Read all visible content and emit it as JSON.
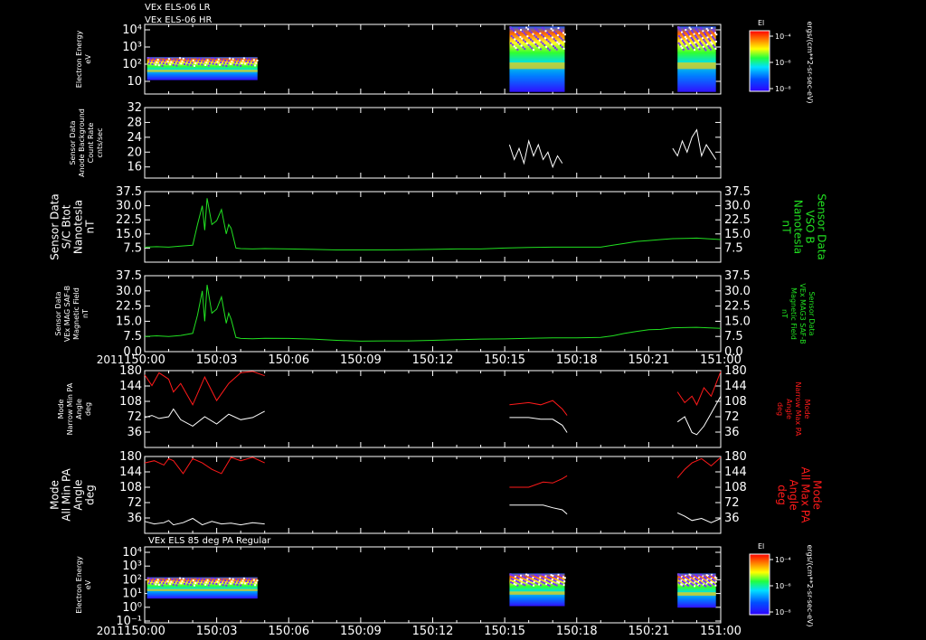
{
  "header": {
    "line1": "VEx ELS-06 LR",
    "line2": "VEx ELS-06 HR"
  },
  "colors": {
    "bg": "#000000",
    "axis": "#ffffff",
    "green": "#21e021",
    "red": "#ff1a1a",
    "white": "#ffffff"
  },
  "x_axis": {
    "year": "2011",
    "ticks": [
      "150:00",
      "150:03",
      "150:06",
      "150:09",
      "150:12",
      "150:15",
      "150:18",
      "150:21",
      "151:00"
    ]
  },
  "panels": {
    "energy1": {
      "ylabel": [
        "Electron Energy",
        "eV"
      ],
      "yticks": [
        "10⁴",
        "10³",
        "10²",
        "10"
      ],
      "colorbar": {
        "title": "El",
        "ticks": [
          "10⁻⁴",
          "10⁻⁶",
          "10⁻⁸"
        ],
        "unit": "ergs/(cm**2-sr-sec-eV)"
      }
    },
    "sensor": {
      "ylabel": [
        "Sensor Data",
        "Anode Background",
        "Count Rate",
        "cnts/sec"
      ],
      "yticks": [
        "32",
        "28",
        "24",
        "20",
        "16"
      ]
    },
    "bmag1": {
      "ylabel": [
        "Sensor Data",
        "S/C Btot",
        "Nanotesla",
        "nT"
      ],
      "yticks": [
        "37.5",
        "30.0",
        "22.5",
        "15.0",
        "7.5"
      ],
      "rlabel": [
        "Sensor Data",
        "VSO B",
        "Nanotesla",
        "nT"
      ]
    },
    "bmag2": {
      "ylabel": [
        "Sensor Data",
        "VEx MAG SAF-B",
        "Magnetic Field",
        "nT"
      ],
      "yticks": [
        "37.5",
        "30.0",
        "22.5",
        "15.0",
        "7.5",
        "0.0"
      ],
      "rlabel": [
        "Sensor Data",
        "VEx MAG3 SAF-B",
        "Magnetic Field",
        "nT"
      ]
    },
    "pa_narrow": {
      "ylabel": [
        "Mode",
        "Narrow Min PA",
        "Angle",
        "deg"
      ],
      "yticks": [
        "180",
        "144",
        "108",
        "72",
        "36"
      ],
      "rlabel": [
        "Mode",
        "Narrow Max PA",
        "Angle",
        "deg"
      ]
    },
    "pa_all": {
      "ylabel": [
        "Mode",
        "All Min PA",
        "Angle",
        "deg"
      ],
      "yticks": [
        "180",
        "144",
        "108",
        "72",
        "36"
      ],
      "rlabel": [
        "Mode",
        "All Max PA",
        "Angle",
        "deg"
      ]
    },
    "energy2": {
      "title": "VEx ELS 85 deg PA Regular",
      "ylabel": [
        "Electron Energy",
        "eV"
      ],
      "yticks": [
        "10⁴",
        "10³",
        "10²",
        "10¹",
        "10⁰",
        "10⁻¹"
      ],
      "colorbar": {
        "title": "El",
        "ticks": [
          "10⁻⁴",
          "10⁻⁶",
          "10⁻⁸"
        ],
        "unit": "ergs/(cm**2-sr-sec-eV)"
      }
    }
  },
  "chart_data": [
    {
      "type": "line",
      "title": "",
      "ylabel": "Sensor Data S/C Btot Nanotesla nT",
      "xlabel": "",
      "xlim": [
        0,
        24
      ],
      "ylim": [
        0,
        37.5
      ],
      "series": [
        {
          "color": "#21e021",
          "x": [
            0,
            0.5,
            1,
            1.5,
            2,
            2.2,
            2.4,
            2.5,
            2.6,
            2.8,
            3,
            3.2,
            3.4,
            3.5,
            3.6,
            3.8,
            4,
            4.5,
            5,
            6,
            7,
            8,
            9,
            10,
            11,
            12,
            13,
            14,
            15,
            16,
            17,
            18,
            19,
            19.5,
            20,
            20.5,
            21,
            21.5,
            22,
            23,
            24
          ],
          "y": [
            8,
            8.2,
            8,
            8.5,
            9,
            20,
            30,
            17,
            34,
            20,
            22,
            28,
            15,
            20,
            18,
            7.5,
            7.2,
            7,
            7.2,
            7,
            6.8,
            6.5,
            6.5,
            6.5,
            6.6,
            6.8,
            7,
            7,
            7.5,
            7.8,
            8,
            8,
            8,
            9,
            10,
            11,
            11.5,
            12,
            12.5,
            12.8,
            12
          ]
        }
      ]
    },
    {
      "type": "line",
      "title": "",
      "ylabel": "Sensor Data VEx MAG SAF-B Magnetic Field nT",
      "xlabel": "",
      "xlim": [
        0,
        24
      ],
      "ylim": [
        0,
        37.5
      ],
      "series": [
        {
          "color": "#21e021",
          "x": [
            0,
            0.5,
            1,
            1.5,
            2,
            2.2,
            2.4,
            2.5,
            2.6,
            2.8,
            3,
            3.2,
            3.4,
            3.5,
            3.6,
            3.8,
            4,
            4.5,
            5,
            6,
            7,
            8,
            9,
            10,
            11,
            12,
            13,
            14,
            15,
            16,
            17,
            18,
            19,
            19.5,
            20,
            20.5,
            21,
            21.5,
            22,
            23,
            24
          ],
          "y": [
            7.5,
            7.8,
            7.5,
            8,
            9,
            18,
            30,
            15,
            33,
            19,
            21,
            27,
            14,
            19,
            16,
            7,
            6.5,
            6.4,
            6.6,
            6.5,
            6.2,
            5.6,
            5.2,
            5.3,
            5.3,
            5.6,
            5.9,
            6.2,
            6.3,
            6.6,
            6.8,
            6.8,
            7,
            7.8,
            9,
            10,
            10.8,
            11,
            11.8,
            12,
            11.5
          ]
        }
      ]
    },
    {
      "type": "line",
      "title": "",
      "ylabel": "Sensor Data Anode Background Count Rate cnts/sec",
      "ylim": [
        13,
        32
      ],
      "series": [
        {
          "color": "#ffffff",
          "x": [
            15.2,
            15.4,
            15.6,
            15.8,
            16,
            16.2,
            16.4,
            16.6,
            16.8,
            17,
            17.2,
            17.4,
            22.0,
            22.2,
            22.4,
            22.6,
            22.8,
            23,
            23.2,
            23.4,
            23.6,
            23.8
          ],
          "y": [
            22,
            18,
            21,
            17,
            23,
            19,
            22,
            18,
            20,
            16,
            19,
            17,
            21,
            19,
            23,
            20,
            24,
            26,
            19,
            22,
            20,
            18
          ]
        }
      ]
    },
    {
      "type": "line",
      "title": "",
      "ylabel": "Mode Narrow Min PA Angle deg",
      "ylim": [
        0,
        180
      ],
      "series": [
        {
          "color": "#ff1a1a",
          "x": [
            0,
            0.3,
            0.6,
            1,
            1.2,
            1.5,
            2,
            2.5,
            3,
            3.5,
            4,
            4.5,
            5,
            15.2,
            16,
            16.5,
            17,
            17.4,
            17.6,
            22.2,
            22.5,
            22.8,
            23,
            23.3,
            23.6,
            24
          ],
          "y": [
            170,
            145,
            175,
            160,
            130,
            150,
            100,
            165,
            110,
            150,
            175,
            178,
            168,
            100,
            105,
            100,
            110,
            90,
            75,
            130,
            105,
            120,
            100,
            140,
            120,
            178
          ]
        },
        {
          "color": "#ffffff",
          "x": [
            0,
            0.3,
            0.6,
            1,
            1.2,
            1.5,
            2,
            2.5,
            3,
            3.5,
            4,
            4.5,
            5,
            15.2,
            16,
            16.5,
            17,
            17.4,
            17.6,
            22.2,
            22.5,
            22.8,
            23,
            23.3,
            23.6,
            24
          ],
          "y": [
            70,
            75,
            68,
            72,
            90,
            65,
            50,
            72,
            55,
            78,
            65,
            70,
            85,
            70,
            70,
            66,
            66,
            52,
            35,
            60,
            72,
            35,
            30,
            50,
            80,
            120
          ]
        }
      ]
    },
    {
      "type": "line",
      "title": "",
      "ylabel": "Mode All Min PA Angle deg",
      "ylim": [
        0,
        180
      ],
      "series": [
        {
          "color": "#ff1a1a",
          "x": [
            0,
            0.4,
            0.8,
            1,
            1.2,
            1.6,
            2,
            2.4,
            2.8,
            3.2,
            3.6,
            4,
            4.5,
            5,
            15.2,
            16,
            16.6,
            17,
            17.4,
            17.6,
            22.2,
            22.5,
            22.8,
            23.2,
            23.6,
            24
          ],
          "y": [
            165,
            170,
            160,
            175,
            170,
            140,
            175,
            165,
            150,
            140,
            178,
            170,
            178,
            165,
            108,
            108,
            120,
            118,
            128,
            135,
            130,
            150,
            165,
            175,
            158,
            178
          ]
        },
        {
          "color": "#ffffff",
          "x": [
            0,
            0.4,
            0.8,
            1,
            1.2,
            1.6,
            2,
            2.4,
            2.8,
            3.2,
            3.6,
            4,
            4.5,
            5,
            15.2,
            16,
            16.6,
            17,
            17.4,
            17.6,
            22.2,
            22.5,
            22.8,
            23.2,
            23.6,
            24
          ],
          "y": [
            28,
            22,
            25,
            30,
            20,
            25,
            35,
            20,
            28,
            22,
            24,
            20,
            25,
            22,
            66,
            66,
            66,
            60,
            55,
            45,
            48,
            40,
            30,
            35,
            25,
            35
          ]
        }
      ]
    }
  ]
}
